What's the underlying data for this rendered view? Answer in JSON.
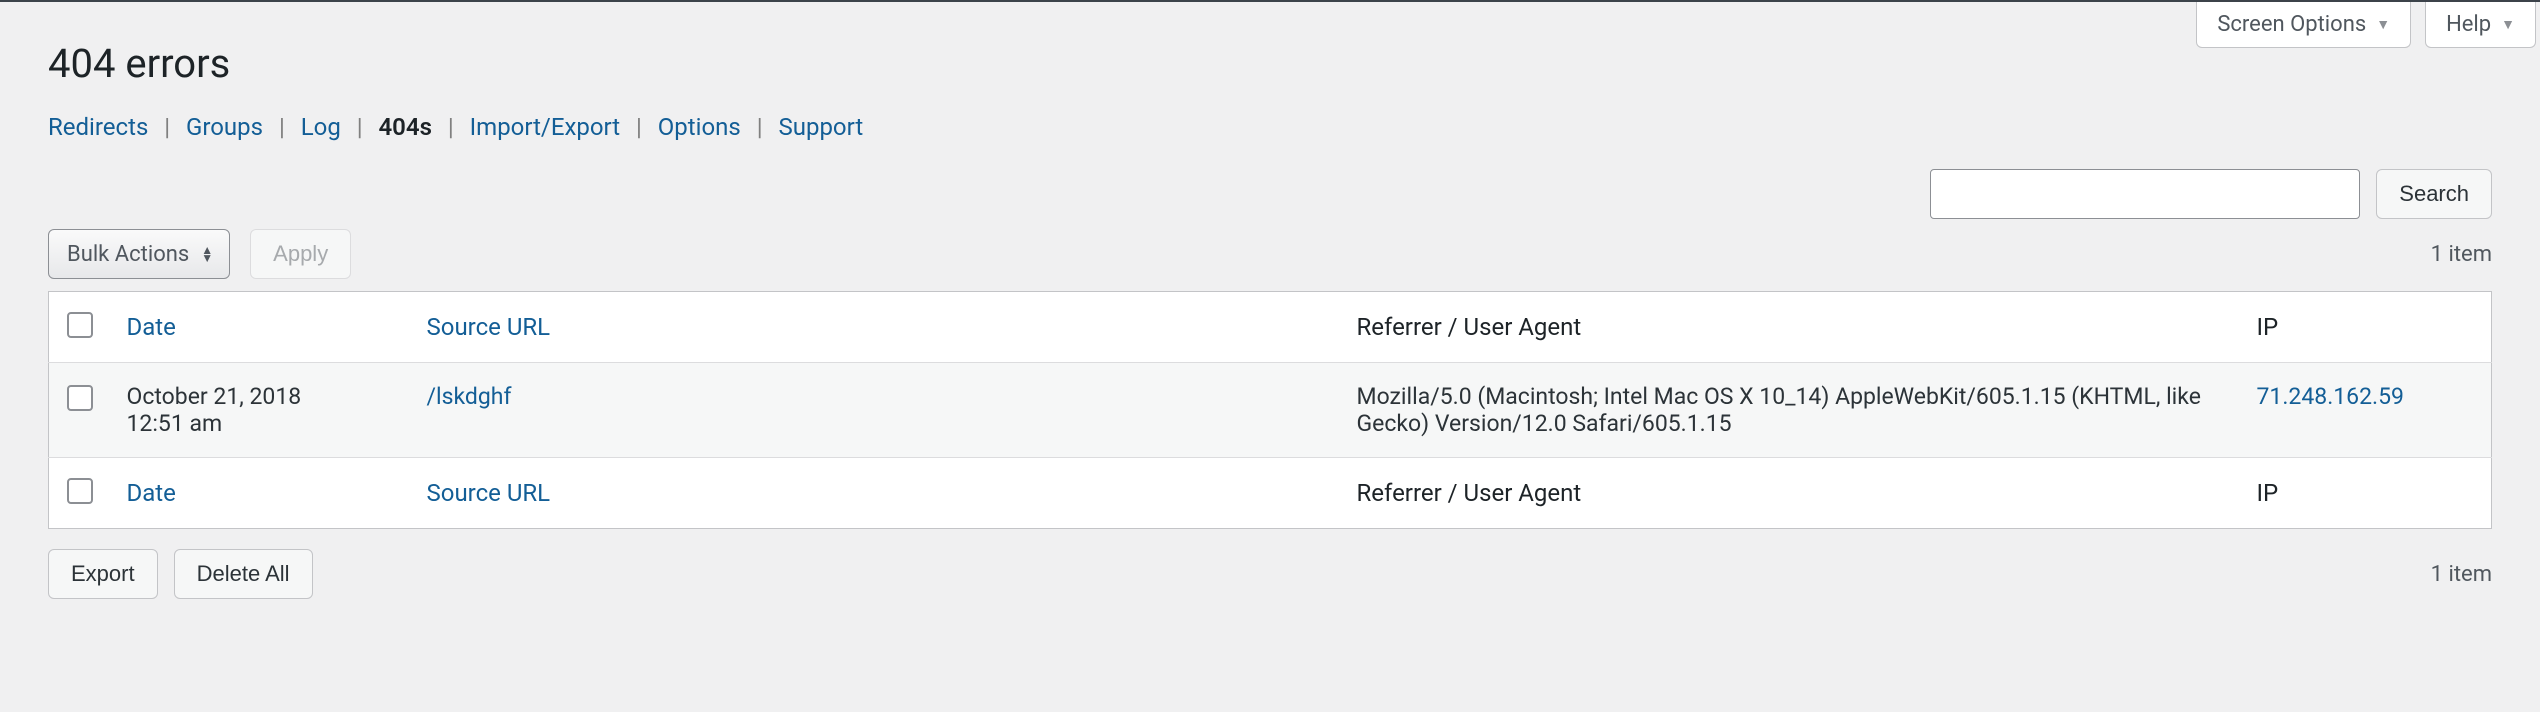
{
  "topbar": {
    "screen_options": "Screen Options",
    "help": "Help"
  },
  "page_title": "404 errors",
  "nav": {
    "redirects": "Redirects",
    "groups": "Groups",
    "log": "Log",
    "f404s": "404s",
    "import_export": "Import/Export",
    "options": "Options",
    "support": "Support"
  },
  "search": {
    "button": "Search",
    "placeholder": ""
  },
  "bulk": {
    "label": "Bulk Actions",
    "apply": "Apply"
  },
  "count": {
    "top": "1 item",
    "bottom": "1 item"
  },
  "columns": {
    "date": "Date",
    "source": "Source URL",
    "referrer": "Referrer / User Agent",
    "ip": "IP"
  },
  "rows": [
    {
      "date_line1": "October 21, 2018",
      "date_line2": "12:51 am",
      "url": "/lskdghf",
      "referrer": "Mozilla/5.0 (Macintosh; Intel Mac OS X 10_14) AppleWebKit/605.1.15 (KHTML, like Gecko) Version/12.0 Safari/605.1.15",
      "ip": "71.248.162.59"
    }
  ],
  "actions": {
    "export": "Export",
    "delete_all": "Delete All"
  }
}
